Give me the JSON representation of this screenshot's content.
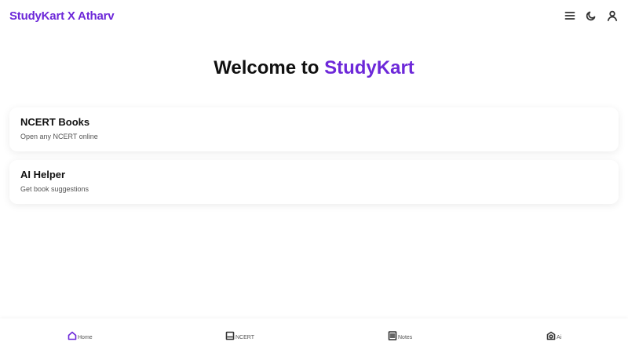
{
  "header": {
    "brand": "StudyKart X Atharv",
    "icons": [
      "menu-icon",
      "moon-icon",
      "user-icon"
    ]
  },
  "hero": {
    "prefix": "Welcome to",
    "accent": "StudyKart"
  },
  "cards": [
    {
      "title": "NCERT Books",
      "subtitle": "Open any NCERT online"
    },
    {
      "title": "AI Helper",
      "subtitle": "Get book suggestions"
    }
  ],
  "bottom_nav": [
    {
      "label": "Home",
      "icon": "home-icon",
      "active": true
    },
    {
      "label": "NCERT",
      "icon": "book-icon",
      "active": false
    },
    {
      "label": "Notes",
      "icon": "notes-icon",
      "active": false
    },
    {
      "label": "Ai",
      "icon": "ai-icon",
      "active": false
    }
  ],
  "colors": {
    "accent": "#6d28d9",
    "text": "#111111",
    "muted": "#555555",
    "background": "#ffffff"
  }
}
